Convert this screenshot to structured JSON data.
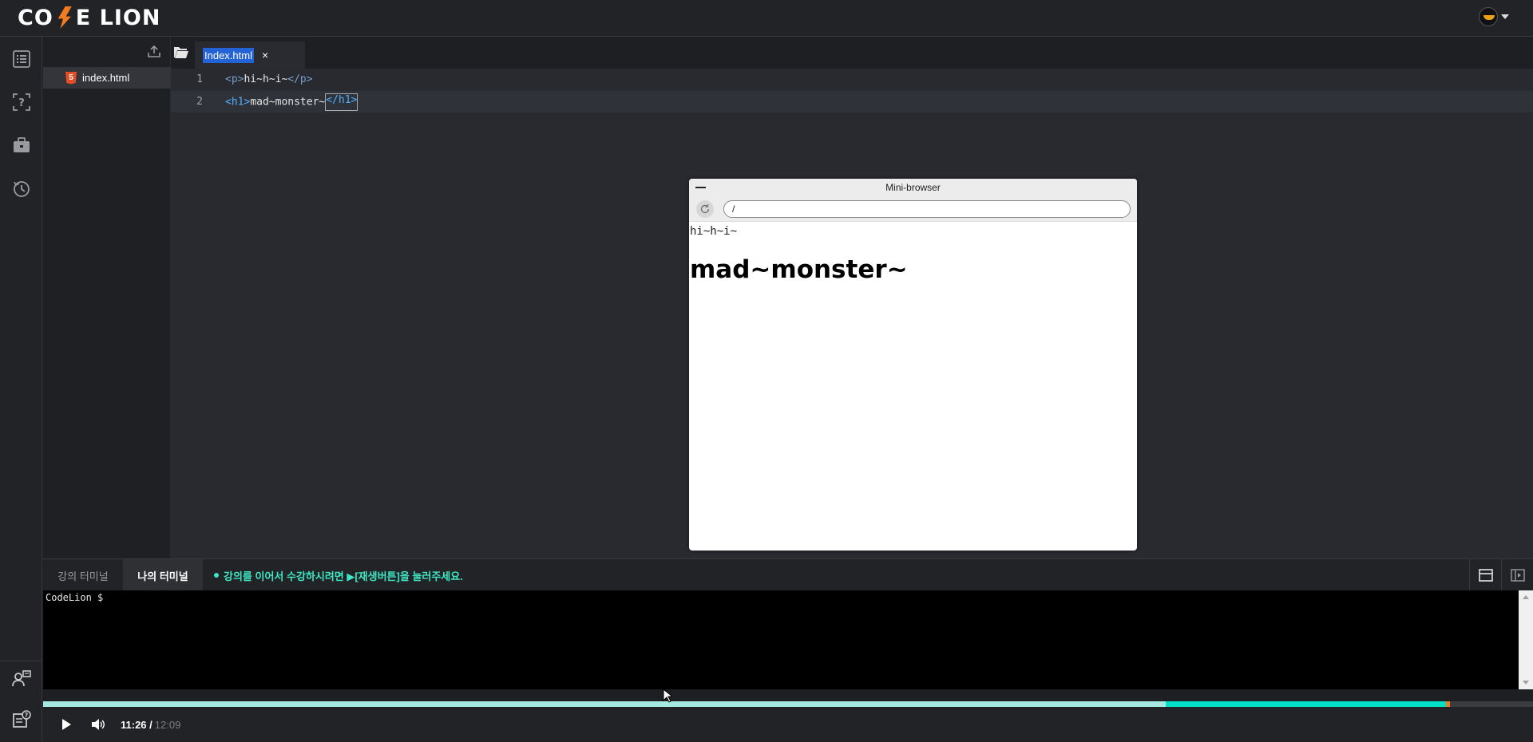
{
  "brand": {
    "logo_text_left": "CO",
    "logo_text_right": "E LION",
    "accent": "#f47b20"
  },
  "rail": {
    "items": [
      {
        "name": "curriculum-list-icon"
      },
      {
        "name": "question-icon"
      },
      {
        "name": "briefcase-icon"
      },
      {
        "name": "history-icon"
      }
    ],
    "bottom": [
      {
        "name": "mentor-chat-icon"
      },
      {
        "name": "help-notes-icon"
      }
    ]
  },
  "explorer": {
    "files": [
      {
        "name": "index.html",
        "icon": "html5-icon"
      }
    ]
  },
  "editor": {
    "tab": {
      "label": "Index.html",
      "close": "×"
    },
    "lines": [
      {
        "number": "1",
        "open": "<p>",
        "text": "hi~h~i~",
        "close": "</p>"
      },
      {
        "number": "2",
        "open": "<h1>",
        "text": "mad~monster~",
        "close": "</h1>"
      }
    ]
  },
  "mini_browser": {
    "title": "Mini-browser",
    "url": "/",
    "paragraph": "hi~h~i~",
    "heading": "mad~monster~"
  },
  "terminal": {
    "tab_lecture": "강의 터미널",
    "tab_mine": "나의 터미널",
    "notice": "강의를 이어서 수강하시려면  ▶[재생버튼]을 눌러주세요.",
    "prompt": "CodeLion $",
    "notice_color": "#3ee6c4"
  },
  "player": {
    "current_time": "11:26 /",
    "total_time": "12:09",
    "progress_played": 0.7535,
    "progress_buffered_to": 0.9418
  }
}
